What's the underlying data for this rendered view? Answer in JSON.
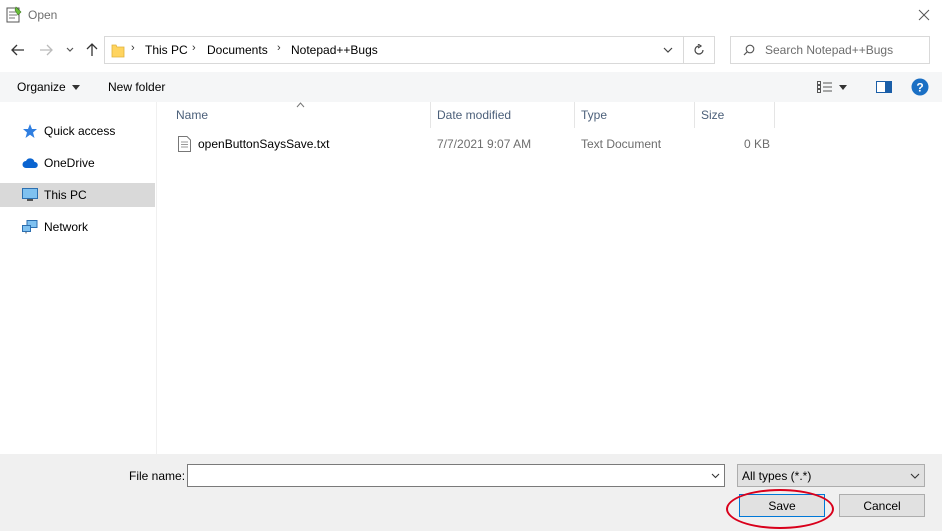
{
  "window": {
    "title": "Open"
  },
  "address": {
    "breadcrumbs": [
      "This PC",
      "Documents",
      "Notepad++Bugs"
    ]
  },
  "search": {
    "placeholder": "Search Notepad++Bugs"
  },
  "toolbar": {
    "organize_label": "Organize",
    "new_folder_label": "New folder"
  },
  "nav": {
    "items": [
      {
        "label": "Quick access",
        "icon": "star-icon",
        "selected": false
      },
      {
        "label": "OneDrive",
        "icon": "cloud-icon",
        "selected": false
      },
      {
        "label": "This PC",
        "icon": "computer-icon",
        "selected": true
      },
      {
        "label": "Network",
        "icon": "network-icon",
        "selected": false
      }
    ]
  },
  "file_list": {
    "columns": [
      "Name",
      "Date modified",
      "Type",
      "Size"
    ],
    "sort_column": "Name",
    "rows": [
      {
        "name": "openButtonSaysSave.txt",
        "date_modified": "7/7/2021 9:07 AM",
        "type": "Text Document",
        "size": "0 KB",
        "icon": "text-file-icon"
      }
    ]
  },
  "footer": {
    "file_name_label": "File name:",
    "file_name_value": "",
    "file_type": "All types (*.*)",
    "save_label": "Save",
    "cancel_label": "Cancel"
  },
  "colors": {
    "annotation": "#d9001b",
    "accent": "#0078d7",
    "folder": "#ffd45f",
    "selected_nav": "#d9d9d9"
  }
}
